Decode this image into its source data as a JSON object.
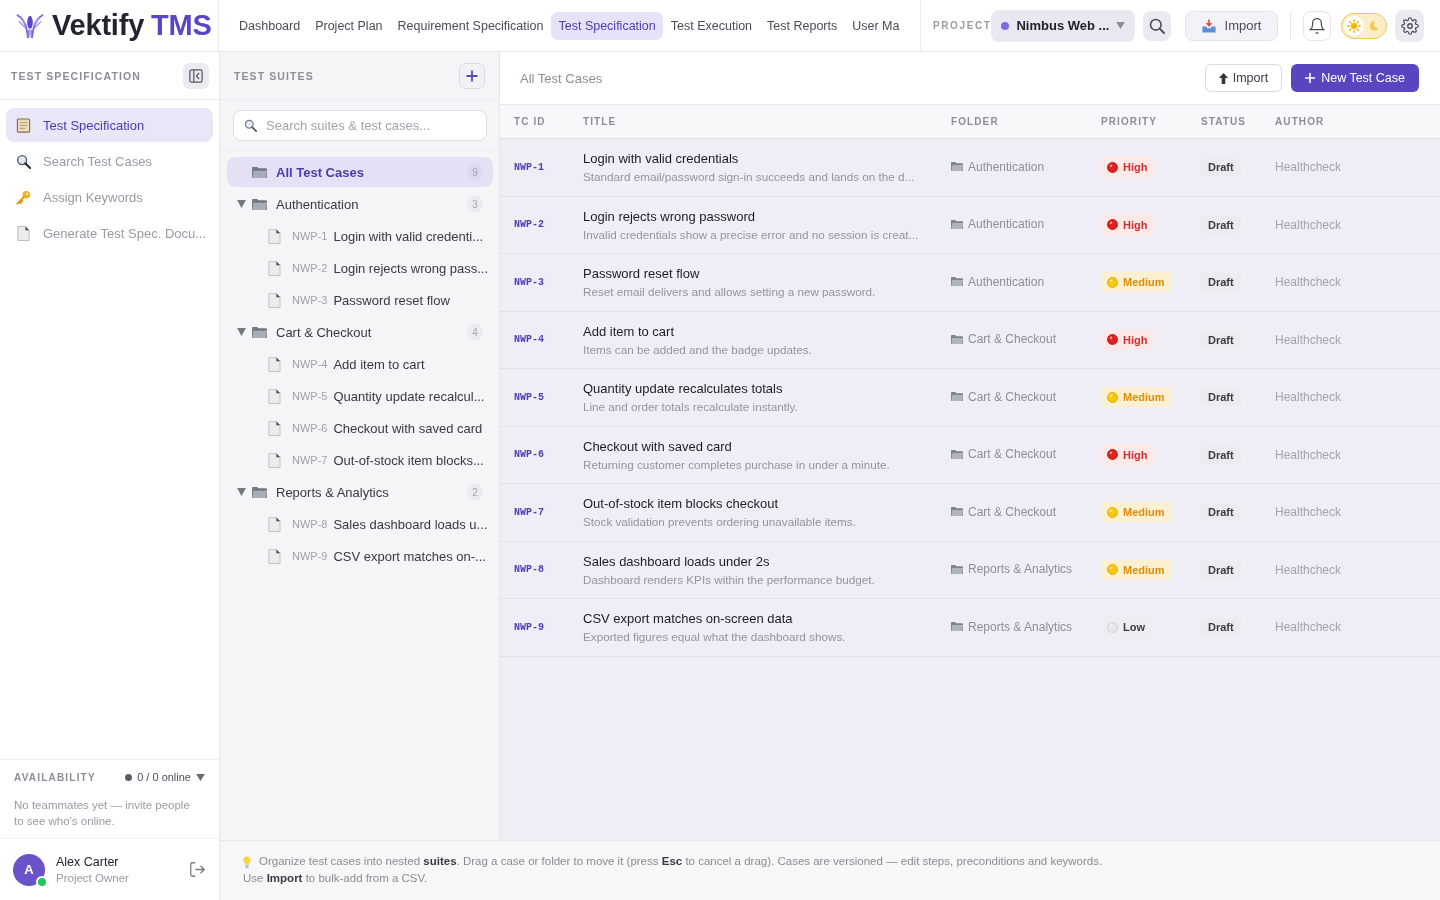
{
  "brand": {
    "name": "Vektify",
    "suffix": "TMS"
  },
  "nav": [
    {
      "label": "Dashboard",
      "selected": false
    },
    {
      "label": "Project Plan",
      "selected": false
    },
    {
      "label": "Requirement Specification",
      "selected": false
    },
    {
      "label": "Test Specification",
      "selected": true
    },
    {
      "label": "Test Execution",
      "selected": false
    },
    {
      "label": "Test Reports",
      "selected": false
    },
    {
      "label": "User Ma",
      "selected": false
    }
  ],
  "project": {
    "label": "PROJECT",
    "value": "Nimbus Web ..."
  },
  "toolbar": {
    "import_label": "Import",
    "theme_toggle": {
      "on": false
    }
  },
  "sidebar": {
    "title": "TEST SPECIFICATION",
    "items": [
      {
        "label": "Test Specification",
        "selected": true
      },
      {
        "label": "Search Test Cases",
        "selected": false
      },
      {
        "label": "Assign Keywords",
        "selected": false
      },
      {
        "label": "Generate Test Spec. Docu...",
        "selected": false
      }
    ]
  },
  "availability": {
    "label": "AVAILABILITY",
    "status": "0 / 0 online",
    "message": "No teammates yet — invite people to see who's online."
  },
  "user": {
    "initial": "A",
    "name": "Alex Carter",
    "role": "Project Owner",
    "online": true
  },
  "suites": {
    "title": "TEST SUITES",
    "search": {
      "placeholder": "Search suites & test cases..."
    },
    "tree": [
      {
        "kind": "all",
        "label": "All Test Cases",
        "count": "9",
        "selected": true
      },
      {
        "kind": "folder",
        "label": "Authentication",
        "count": "3",
        "selected": false,
        "expanded": true,
        "children": [
          {
            "id": "NWP-1",
            "title": "Login with valid credenti...",
            "selected": false
          },
          {
            "id": "NWP-2",
            "title": "Login rejects wrong pass...",
            "selected": false
          },
          {
            "id": "NWP-3",
            "title": "Password reset flow",
            "selected": false
          }
        ]
      },
      {
        "kind": "folder",
        "label": "Cart & Checkout",
        "count": "4",
        "selected": false,
        "expanded": true,
        "children": [
          {
            "id": "NWP-4",
            "title": "Add item to cart",
            "selected": false
          },
          {
            "id": "NWP-5",
            "title": "Quantity update recalcul...",
            "selected": false
          },
          {
            "id": "NWP-6",
            "title": "Checkout with saved card",
            "selected": false
          },
          {
            "id": "NWP-7",
            "title": "Out-of-stock item blocks...",
            "selected": false
          }
        ]
      },
      {
        "kind": "folder",
        "label": "Reports & Analytics",
        "count": "2",
        "selected": false,
        "expanded": true,
        "children": [
          {
            "id": "NWP-8",
            "title": "Sales dashboard loads u...",
            "selected": false
          },
          {
            "id": "NWP-9",
            "title": "CSV export matches on-...",
            "selected": false
          }
        ]
      }
    ]
  },
  "main": {
    "heading": "All Test Cases",
    "import_label": "Import",
    "new_label": "New Test Case"
  },
  "table": {
    "columns": [
      "TC ID",
      "TITLE",
      "FOLDER",
      "PRIORITY",
      "STATUS",
      "AUTHOR"
    ],
    "rows": [
      {
        "id": "NWP-1",
        "title": "Login with valid credentials",
        "description": "Standard email/password sign-in succeeds and lands on the d...",
        "folder": "Authentication",
        "priority": {
          "label": "High",
          "kind": "high"
        },
        "status": "Draft",
        "author": "Healthcheck"
      },
      {
        "id": "NWP-2",
        "title": "Login rejects wrong password",
        "description": "Invalid credentials show a precise error and no session is creat...",
        "folder": "Authentication",
        "priority": {
          "label": "High",
          "kind": "high"
        },
        "status": "Draft",
        "author": "Healthcheck"
      },
      {
        "id": "NWP-3",
        "title": "Password reset flow",
        "description": "Reset email delivers and allows setting a new password.",
        "folder": "Authentication",
        "priority": {
          "label": "Medium",
          "kind": "medium"
        },
        "status": "Draft",
        "author": "Healthcheck"
      },
      {
        "id": "NWP-4",
        "title": "Add item to cart",
        "description": "Items can be added and the badge updates.",
        "folder": "Cart & Checkout",
        "priority": {
          "label": "High",
          "kind": "high"
        },
        "status": "Draft",
        "author": "Healthcheck"
      },
      {
        "id": "NWP-5",
        "title": "Quantity update recalculates totals",
        "description": "Line and order totals recalculate instantly.",
        "folder": "Cart & Checkout",
        "priority": {
          "label": "Medium",
          "kind": "medium"
        },
        "status": "Draft",
        "author": "Healthcheck"
      },
      {
        "id": "NWP-6",
        "title": "Checkout with saved card",
        "description": "Returning customer completes purchase in under a minute.",
        "folder": "Cart & Checkout",
        "priority": {
          "label": "High",
          "kind": "high"
        },
        "status": "Draft",
        "author": "Healthcheck"
      },
      {
        "id": "NWP-7",
        "title": "Out-of-stock item blocks checkout",
        "description": "Stock validation prevents ordering unavailable items.",
        "folder": "Cart & Checkout",
        "priority": {
          "label": "Medium",
          "kind": "medium"
        },
        "status": "Draft",
        "author": "Healthcheck"
      },
      {
        "id": "NWP-8",
        "title": "Sales dashboard loads under 2s",
        "description": "Dashboard renders KPIs within the performance budget.",
        "folder": "Reports & Analytics",
        "priority": {
          "label": "Medium",
          "kind": "medium"
        },
        "status": "Draft",
        "author": "Healthcheck"
      },
      {
        "id": "NWP-9",
        "title": "CSV export matches on-screen data",
        "description": "Exported figures equal what the dashboard shows.",
        "folder": "Reports & Analytics",
        "priority": {
          "label": "Low",
          "kind": "low"
        },
        "status": "Draft",
        "author": "Healthcheck"
      }
    ]
  },
  "footer": {
    "lines": [
      "Organize test cases into nested **suites**. Drag a case or folder to move it (press **Esc** to cancel a drag). Cases are versioned — edit steps, preconditions and keywords.",
      "Use **Import** to bulk-add from a CSV."
    ]
  }
}
